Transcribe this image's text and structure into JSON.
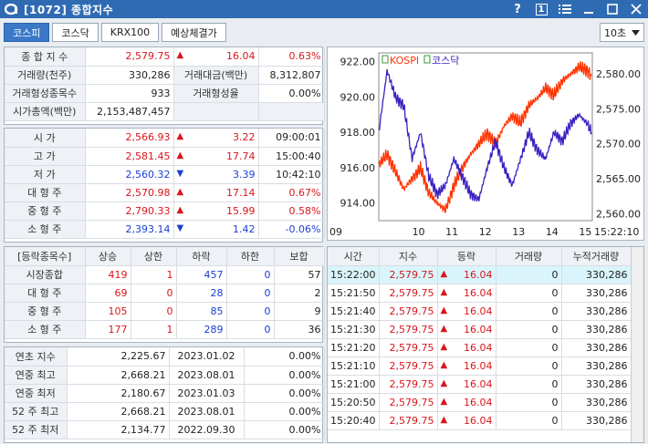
{
  "window": {
    "title": "[1072] 종합지수",
    "help": "?",
    "page_num": "1"
  },
  "tabs": [
    {
      "label": "코스피",
      "active": true
    },
    {
      "label": "코스닥",
      "active": false
    },
    {
      "label": "KRX100",
      "active": false
    },
    {
      "label": "예상체결가",
      "active": false
    }
  ],
  "interval_select": {
    "value": "10초"
  },
  "summary": {
    "index_label": "종 합 지 수",
    "index_value": "2,579.75",
    "index_change": "16.04",
    "index_rate": "0.63%",
    "volume_label": "거래량(천주)",
    "volume_value": "330,286",
    "amount_label": "거래대금(백만)",
    "amount_value": "8,312,807",
    "formed_count_label": "거래형성종목수",
    "formed_count_value": "933",
    "formed_rate_label": "거래형성율",
    "formed_rate_value": "0.00%",
    "mcap_label": "시가총액(백만)",
    "mcap_value": "2,153,487,457"
  },
  "prices": [
    {
      "label": "시      가",
      "value": "2,566.93",
      "dir": "up",
      "change": "3.22",
      "extra": "09:00:01",
      "color": "red",
      "extra_color": ""
    },
    {
      "label": "고      가",
      "value": "2,581.45",
      "dir": "up",
      "change": "17.74",
      "extra": "15:00:40",
      "color": "red",
      "extra_color": ""
    },
    {
      "label": "저      가",
      "value": "2,560.32",
      "dir": "down",
      "change": "3.39",
      "extra": "10:42:10",
      "color": "blue",
      "extra_color": ""
    },
    {
      "label": "대 형 주",
      "value": "2,570.98",
      "dir": "up",
      "change": "17.14",
      "extra": "0.67%",
      "color": "red",
      "extra_color": "red"
    },
    {
      "label": "중 형 주",
      "value": "2,790.33",
      "dir": "up",
      "change": "15.99",
      "extra": "0.58%",
      "color": "red",
      "extra_color": "red"
    },
    {
      "label": "소 형 주",
      "value": "2,393.14",
      "dir": "down",
      "change": "1.42",
      "extra": "-0.06%",
      "color": "blue",
      "extra_color": "blue"
    }
  ],
  "breadth": {
    "headers": [
      "[등락종목수]",
      "상승",
      "상한",
      "하락",
      "하한",
      "보합"
    ],
    "rows": [
      {
        "label": "시장종합",
        "values": [
          "419",
          "1",
          "457",
          "0",
          "57"
        ]
      },
      {
        "label": "대 형 주",
        "values": [
          "69",
          "0",
          "28",
          "0",
          "2"
        ]
      },
      {
        "label": "중 형 주",
        "values": [
          "105",
          "0",
          "85",
          "0",
          "9"
        ]
      },
      {
        "label": "소 형 주",
        "values": [
          "177",
          "1",
          "289",
          "0",
          "36"
        ]
      }
    ]
  },
  "yearly": [
    {
      "label": "연초  지수",
      "value": "2,225.67",
      "date": "2023.01.02",
      "rate": "0.00%"
    },
    {
      "label": "연중  최고",
      "value": "2,668.21",
      "date": "2023.08.01",
      "rate": "0.00%"
    },
    {
      "label": "연중  최저",
      "value": "2,180.67",
      "date": "2023.01.03",
      "rate": "0.00%"
    },
    {
      "label": "52 주 최고",
      "value": "2,668.21",
      "date": "2023.08.01",
      "rate": "0.00%"
    },
    {
      "label": "52 주 최저",
      "value": "2,134.77",
      "date": "2022.09.30",
      "rate": "0.00%"
    }
  ],
  "ticks": {
    "headers": [
      "시간",
      "지수",
      "등락",
      "거래량",
      "누적거래량"
    ],
    "rows": [
      {
        "time": "15:22:00",
        "index": "2,579.75",
        "change": "16.04",
        "volume": "0",
        "cum": "330,286"
      },
      {
        "time": "15:21:50",
        "index": "2,579.75",
        "change": "16.04",
        "volume": "0",
        "cum": "330,286"
      },
      {
        "time": "15:21:40",
        "index": "2,579.75",
        "change": "16.04",
        "volume": "0",
        "cum": "330,286"
      },
      {
        "time": "15:21:30",
        "index": "2,579.75",
        "change": "16.04",
        "volume": "0",
        "cum": "330,286"
      },
      {
        "time": "15:21:20",
        "index": "2,579.75",
        "change": "16.04",
        "volume": "0",
        "cum": "330,286"
      },
      {
        "time": "15:21:10",
        "index": "2,579.75",
        "change": "16.04",
        "volume": "0",
        "cum": "330,286"
      },
      {
        "time": "15:21:00",
        "index": "2,579.75",
        "change": "16.04",
        "volume": "0",
        "cum": "330,286"
      },
      {
        "time": "15:20:50",
        "index": "2,579.75",
        "change": "16.04",
        "volume": "0",
        "cum": "330,286"
      },
      {
        "time": "15:20:40",
        "index": "2,579.75",
        "change": "16.04",
        "volume": "0",
        "cum": "330,286"
      }
    ]
  },
  "colors": {
    "up": "#d9161c",
    "down": "#1a3fd1",
    "kospi_line": "#ff3300",
    "kosdaq_line": "#3a20c0",
    "titlebar": "#2f6bb3"
  },
  "chart_data": {
    "type": "line",
    "legend": [
      "KOSPI",
      "코스닥"
    ],
    "x_ticks": [
      "09",
      "10",
      "11",
      "12",
      "13",
      "14",
      "15",
      "15:22:10"
    ],
    "left_axis": {
      "ticks": [
        "922.00",
        "920.00",
        "918.00",
        "916.00",
        "914.00"
      ],
      "range": [
        913.0,
        922.5
      ]
    },
    "right_axis": {
      "ticks": [
        "2,580.00",
        "2,575.00",
        "2,570.00",
        "2,565.00",
        "2,560.00"
      ],
      "range": [
        2559.0,
        2583.0
      ]
    },
    "series": [
      {
        "name": "KOSPI",
        "axis": "right",
        "x": [
          9.0,
          9.25,
          9.5,
          9.75,
          10.0,
          10.25,
          10.5,
          10.75,
          11.0,
          11.25,
          11.5,
          11.75,
          12.0,
          12.25,
          12.5,
          12.75,
          13.0,
          13.25,
          13.5,
          13.75,
          14.0,
          14.25,
          14.5,
          14.75,
          15.0,
          15.25,
          15.37
        ],
        "values": [
          2567.0,
          2568.5,
          2566.0,
          2563.5,
          2565.0,
          2566.5,
          2563.0,
          2561.5,
          2560.5,
          2564.0,
          2566.5,
          2568.5,
          2570.0,
          2571.5,
          2570.0,
          2572.5,
          2574.0,
          2573.0,
          2575.5,
          2576.5,
          2578.0,
          2577.0,
          2579.0,
          2580.0,
          2581.0,
          2580.5,
          2579.75
        ]
      },
      {
        "name": "코스닥",
        "axis": "left",
        "x": [
          9.0,
          9.25,
          9.5,
          9.75,
          10.0,
          10.25,
          10.5,
          10.75,
          11.0,
          11.25,
          11.5,
          11.75,
          12.0,
          12.25,
          12.5,
          12.75,
          13.0,
          13.25,
          13.5,
          13.75,
          14.0,
          14.25,
          14.5,
          14.75,
          15.0,
          15.25,
          15.37
        ],
        "values": [
          918.0,
          921.5,
          920.0,
          919.5,
          916.5,
          918.0,
          915.5,
          914.5,
          915.0,
          916.5,
          915.5,
          914.5,
          914.2,
          916.0,
          917.5,
          916.0,
          915.0,
          916.5,
          918.0,
          917.0,
          916.5,
          918.0,
          917.5,
          918.5,
          919.0,
          918.5,
          918.0
        ]
      }
    ]
  }
}
